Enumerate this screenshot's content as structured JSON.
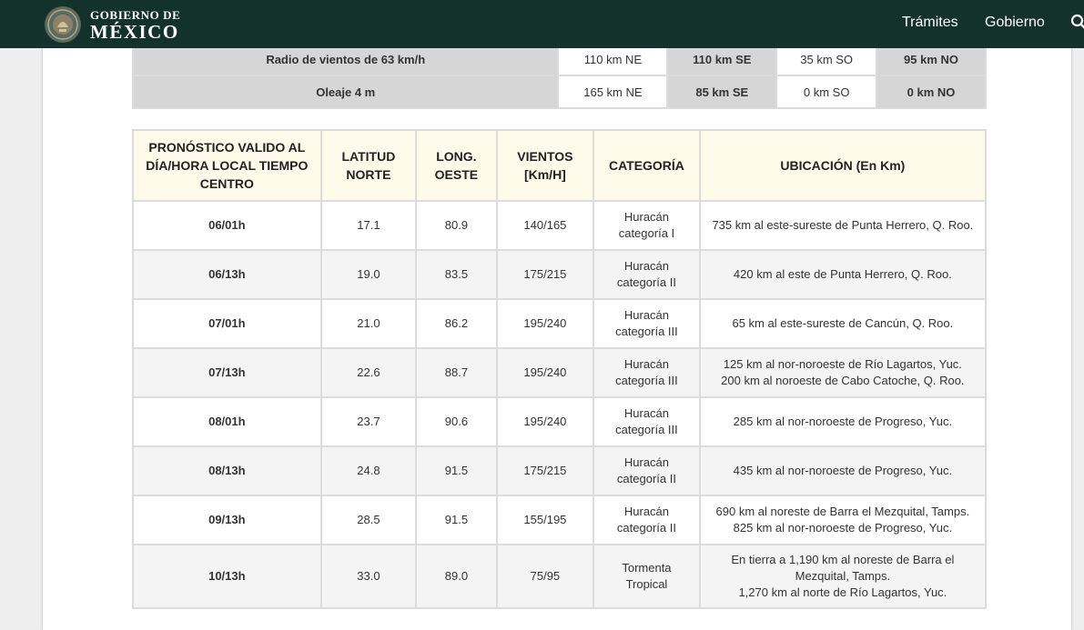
{
  "header": {
    "logo_line1": "GOBIERNO DE",
    "logo_line2": "MÉXICO",
    "nav": [
      "Trámites",
      "Gobierno"
    ],
    "search_icon": "search-icon",
    "bg_color": "#13322b"
  },
  "wind_table": {
    "rows": [
      {
        "label": "Radio de vientos de 63 km/h",
        "ne": "110 km NE",
        "se": "110 km SE",
        "so": "35 km SO",
        "no": "95 km NO"
      },
      {
        "label": "Oleaje 4 m",
        "ne": "165 km NE",
        "se": "85 km SE",
        "so": "0 km SO",
        "no": "0 km NO"
      }
    ]
  },
  "forecast_table": {
    "headers": {
      "fecha": "PRONÓSTICO VALIDO AL DÍA/HORA LOCAL TIEMPO CENTRO",
      "lat": "LATITUD NORTE",
      "lon": "LONG. OESTE",
      "vientos": "VIENTOS [Km/H]",
      "categoria": "CATEGORÍA",
      "ubicacion": "UBICACIÓN (En Km)"
    },
    "header_bg": "#fefaea",
    "rows": [
      {
        "fecha": "06/01h",
        "lat": "17.1",
        "lon": "80.9",
        "vientos": "140/165",
        "categoria": "Huracán categoría I",
        "ubicacion": "735 km al este-sureste de Punta Herrero, Q. Roo."
      },
      {
        "fecha": "06/13h",
        "lat": "19.0",
        "lon": "83.5",
        "vientos": "175/215",
        "categoria": "Huracán categoría II",
        "ubicacion": "420 km al este de Punta Herrero, Q. Roo."
      },
      {
        "fecha": "07/01h",
        "lat": "21.0",
        "lon": "86.2",
        "vientos": "195/240",
        "categoria": "Huracán categoría III",
        "ubicacion": "65 km al este-sureste de Cancún, Q. Roo."
      },
      {
        "fecha": "07/13h",
        "lat": "22.6",
        "lon": "88.7",
        "vientos": "195/240",
        "categoria": "Huracán categoría III",
        "ubicacion": "125 km al nor-noroeste de Río Lagartos, Yuc.\n200 km al noroeste de Cabo Catoche, Q. Roo."
      },
      {
        "fecha": "08/01h",
        "lat": "23.7",
        "lon": "90.6",
        "vientos": "195/240",
        "categoria": "Huracán categoría III",
        "ubicacion": "285 km al nor-noroeste de Progreso, Yuc."
      },
      {
        "fecha": "08/13h",
        "lat": "24.8",
        "lon": "91.5",
        "vientos": "175/215",
        "categoria": "Huracán categoría II",
        "ubicacion": "435 km al nor-noroeste de Progreso, Yuc."
      },
      {
        "fecha": "09/13h",
        "lat": "28.5",
        "lon": "91.5",
        "vientos": "155/195",
        "categoria": "Huracán categoría II",
        "ubicacion": "690 km al noreste de Barra el Mezquital, Tamps.\n825 km al nor-noroeste de Progreso, Yuc."
      },
      {
        "fecha": "10/13h",
        "lat": "33.0",
        "lon": "89.0",
        "vientos": "75/95",
        "categoria": "Tormenta Tropical",
        "ubicacion": "En tierra a 1,190 km al noreste de Barra el\nMezquital, Tamps.\n1,270 km al norte de Río Lagartos, Yuc."
      }
    ]
  }
}
